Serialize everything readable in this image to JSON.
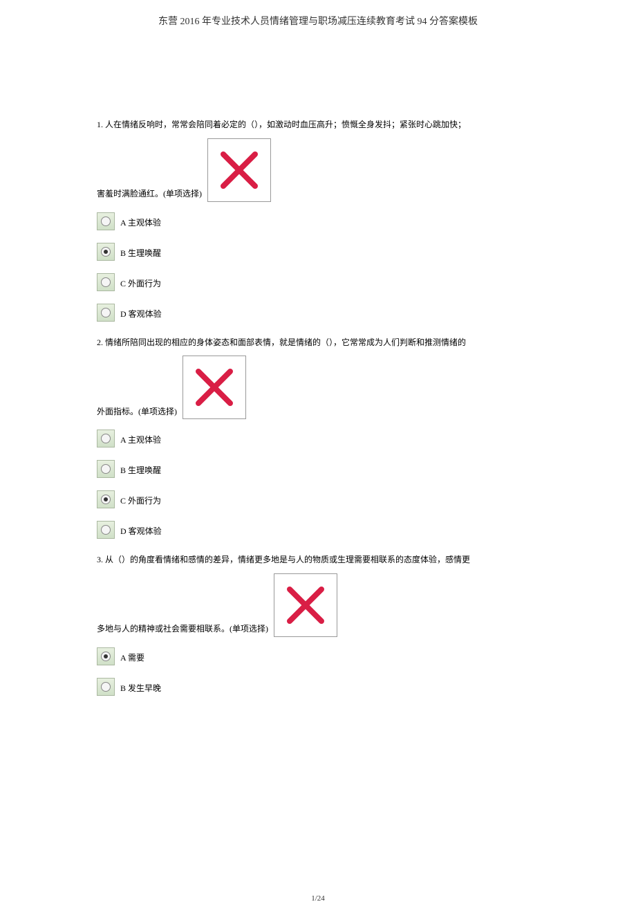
{
  "header": {
    "title": "东营 2016 年专业技术人员情绪管理与职场减压连续教育考试 94 分答案模板"
  },
  "questions": [
    {
      "number": "1.",
      "line1": "人在情绪反响时，常常会陪同着必定的（），如激动时血压高升；愤慨全身发抖；紧张时心跳加快；",
      "line2": "害羞时满脸通红。(单项选择)",
      "options": [
        {
          "label": "A 主观体验",
          "selected": false
        },
        {
          "label": "B 生理唤醒",
          "selected": true
        },
        {
          "label": "C 外面行为",
          "selected": false
        },
        {
          "label": "D 客观体验",
          "selected": false
        }
      ]
    },
    {
      "number": "2.",
      "line1": "情绪所陪同出现的相应的身体姿态和面部表情，就是情绪的（），它常常成为人们判断和推测情绪的",
      "line2": "外面指标。(单项选择)",
      "options": [
        {
          "label": "A 主观体验",
          "selected": false
        },
        {
          "label": "B 生理唤醒",
          "selected": false
        },
        {
          "label": "C 外面行为",
          "selected": true
        },
        {
          "label": "D 客观体验",
          "selected": false
        }
      ]
    },
    {
      "number": "3.",
      "line1": "从（）的角度看情绪和感情的差异，情绪更多地是与人的物质或生理需要相联系的态度体验，感情更",
      "line2": "多地与人的精神或社会需要相联系。(单项选择)",
      "options": [
        {
          "label": "A 需要",
          "selected": true
        },
        {
          "label": "B 发生早晚",
          "selected": false
        }
      ]
    }
  ],
  "footer": {
    "page": "1/24"
  }
}
